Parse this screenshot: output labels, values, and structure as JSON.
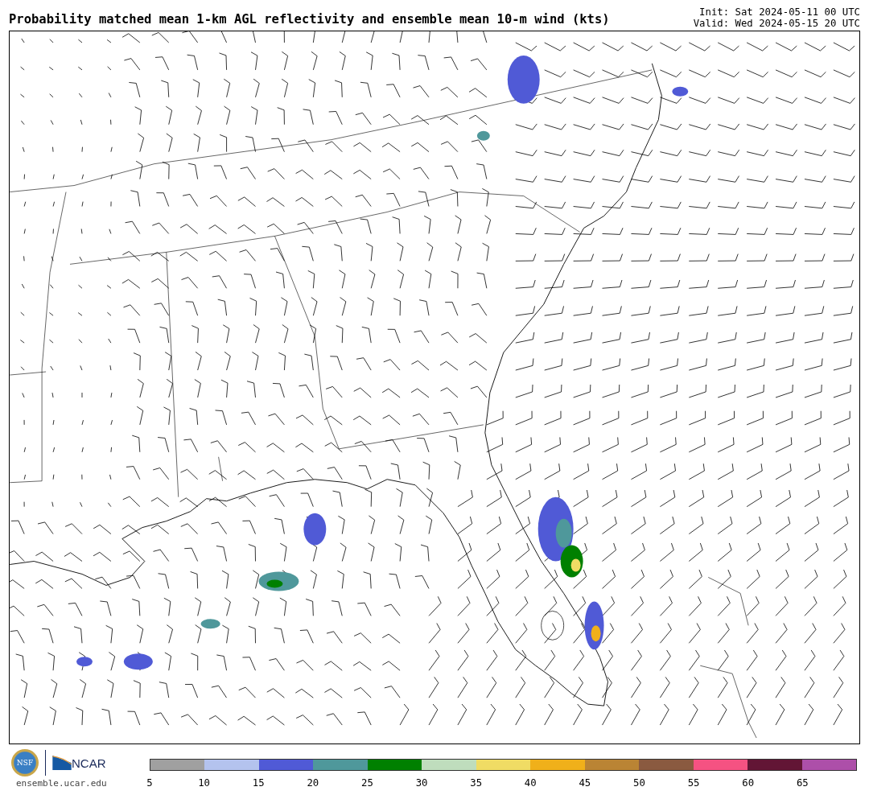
{
  "title": "Probability matched mean 1-km AGL reflectivity and ensemble mean 10-m wind (kts)",
  "init": "Init: Sat 2024-05-11 00 UTC",
  "valid": "Valid: Wed 2024-05-15 20 UTC",
  "logos": {
    "nsf": "NSF",
    "ncar": "NCAR",
    "website": "ensemble.ucar.edu"
  },
  "colorbar": [
    {
      "label": "5",
      "color": "#a0a0a0"
    },
    {
      "label": "10",
      "color": "#b4c3ee"
    },
    {
      "label": "15",
      "color": "#505ad6"
    },
    {
      "label": "20",
      "color": "#4f989b"
    },
    {
      "label": "25",
      "color": "#008000"
    },
    {
      "label": "30",
      "color": "#bfddbd"
    },
    {
      "label": "35",
      "color": "#f0dc64"
    },
    {
      "label": "40",
      "color": "#f0b01a"
    },
    {
      "label": "45",
      "color": "#ba8434"
    },
    {
      "label": "50",
      "color": "#8a5a40"
    },
    {
      "label": "55",
      "color": "#f55282"
    },
    {
      "label": "60",
      "color": "#621535"
    },
    {
      "label": "65",
      "color": "#ad4fa9"
    }
  ]
}
